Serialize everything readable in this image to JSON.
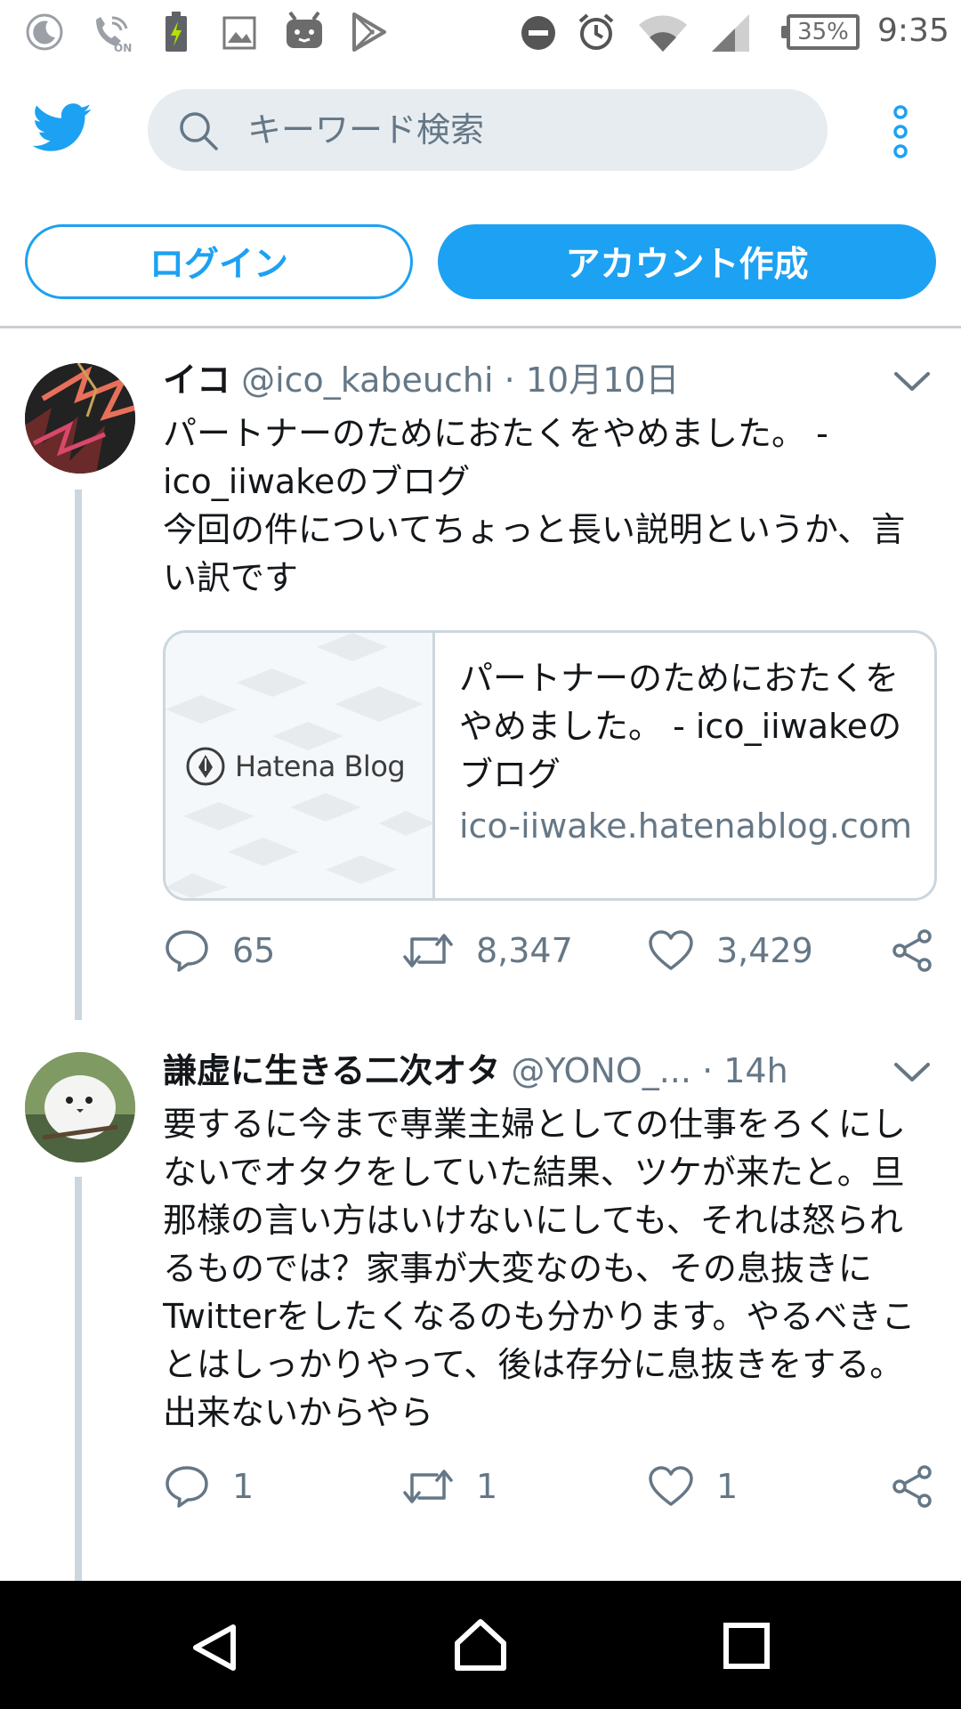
{
  "status_bar": {
    "battery": "35%",
    "time": "9:35",
    "wifi_call_label": "ON",
    "icons": [
      "moon-icon",
      "wifi-calling-icon",
      "battery-saver-icon",
      "image-icon",
      "niconico-icon",
      "play-store-icon",
      "do-not-disturb-icon",
      "alarm-icon",
      "wifi-icon",
      "cell-signal-icon"
    ]
  },
  "header": {
    "logo": "twitter-bird-icon",
    "search_placeholder": "キーワード検索",
    "menu_icon": "more-vertical-icon",
    "login_label": "ログイン",
    "signup_label": "アカウント作成"
  },
  "colors": {
    "brand": "#1da1f2",
    "text": "#14171a",
    "secondary_text": "#657786",
    "search_bg": "#e6ecf0",
    "border": "#ccd6dd"
  },
  "tweets": [
    {
      "name": "イコ",
      "handle": "@ico_kabeuchi",
      "separator": "·",
      "time": "10月10日",
      "text": [
        "パートナーのためにおたくをやめました。 -",
        "ico_iiwakeのブログ",
        "今回の件についてちょっと長い説明というか、言い訳です"
      ],
      "card": {
        "site_logo": "Hatena Blog",
        "title": "パートナーのためにおたくをやめました。 - ico_iiwakeのブログ",
        "url": "ico-iiwake.hatenablog.com"
      },
      "replies": "65",
      "retweets": "8,347",
      "likes": "3,429"
    },
    {
      "name": "謙虚に生きる二次オタ",
      "handle": "@YONO_...",
      "separator": "·",
      "time": "14h",
      "text": [
        "要するに今まで専業主婦としての仕事をろくにしないでオタクをしていた結果、ツケが来たと。旦那様の言い方はいけないにしても、それは怒られるものでは？家事が大変なのも、その息抜きにTwitterをしたくなるのも分かります。やるべきことはしっかりやって、後は存分に息抜きをする。出来ないからやら"
      ],
      "replies": "1",
      "retweets": "1",
      "likes": "1"
    }
  ],
  "nav": {
    "icons": [
      "back-icon",
      "home-icon",
      "recents-icon"
    ]
  }
}
